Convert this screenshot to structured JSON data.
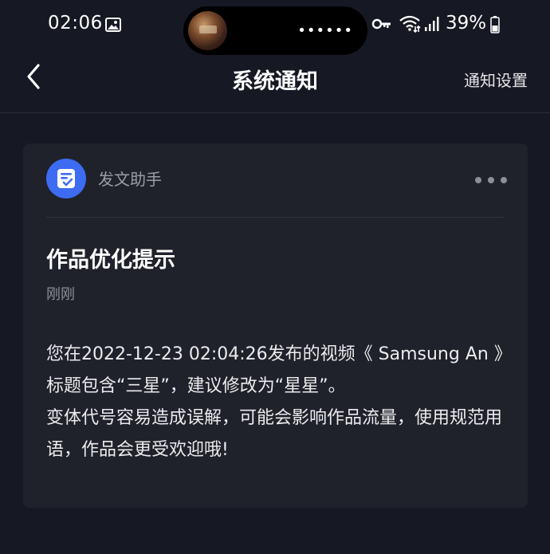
{
  "status_bar": {
    "time": "02:06",
    "pill_dots": "••••••",
    "battery": "39%"
  },
  "nav": {
    "title": "系统通知",
    "settings_label": "通知设置"
  },
  "notification": {
    "sender": "发文助手",
    "title": "作品优化提示",
    "time": "刚刚",
    "body_line1": "您在2022-12-23 02:04:26发布的视频《 Samsung An 》标题包含“三星”，建议修改为“星星”。",
    "body_line2": "变体代号容易造成误解，可能会影响作品流量，使用规范用语，作品会更受欢迎哦!"
  },
  "icons": {
    "back": "chevron-left-icon",
    "more": "more-dots-icon",
    "avatar": "document-check-icon"
  },
  "colors": {
    "background": "#161823",
    "card": "#1f212b",
    "accent": "#3d6cf2",
    "secondary_text": "#8e9099"
  }
}
